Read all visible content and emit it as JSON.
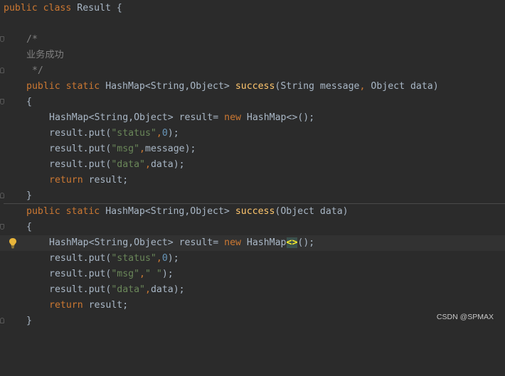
{
  "code": {
    "l1": {
      "kw1": "public",
      "kw2": "class",
      "name": "Result",
      "brace": "{"
    },
    "l3": {
      "text": "/*"
    },
    "l4": {
      "text": "业务成功"
    },
    "l5": {
      "text": " */"
    },
    "l6": {
      "kw1": "public",
      "kw2": "static",
      "type": "HashMap<String,Object>",
      "fn": "success",
      "params_open": "(String message",
      "comma": ",",
      "params_rest": " Object data)"
    },
    "l7": {
      "brace": "{"
    },
    "l8": {
      "type": "HashMap<String,Object> result= ",
      "kw": "new",
      "rest": " HashMap<>();"
    },
    "l9": {
      "pre": "result.put(",
      "str": "\"status\"",
      "comma": ",",
      "num": "0",
      "post": ");"
    },
    "l10": {
      "pre": "result.put(",
      "str": "\"msg\"",
      "comma": ",",
      "post": "message);"
    },
    "l11": {
      "pre": "result.put(",
      "str": "\"data\"",
      "comma": ",",
      "post": "data);"
    },
    "l12": {
      "kw": "return",
      "post": " result;"
    },
    "l13": {
      "brace": "}"
    },
    "l14": {
      "kw1": "public",
      "kw2": "static",
      "type": "HashMap<String,Object>",
      "fn": "success",
      "params": "(Object data)"
    },
    "l15": {
      "brace": "{"
    },
    "l16": {
      "type": "HashMap<String,Object> result= ",
      "kw": "new",
      "mid": " HashMap",
      "hl": "<>",
      "post": "();"
    },
    "l17": {
      "pre": "result.put(",
      "str": "\"status\"",
      "comma": ",",
      "num": "0",
      "post": ");"
    },
    "l18": {
      "pre": "result.put(",
      "str": "\"msg\"",
      "comma": ",",
      "str2": "\" \"",
      "post": ");"
    },
    "l19": {
      "pre": "result.put(",
      "str": "\"data\"",
      "comma": ",",
      "post": "data);"
    },
    "l20": {
      "kw": "return",
      "post": " result;"
    },
    "l21": {
      "brace": "}"
    }
  },
  "watermark": "CSDN @SPMAX",
  "icons": {
    "fold": "fold-marker-icon",
    "bulb": "lightbulb-icon"
  },
  "colors": {
    "background": "#2b2b2b",
    "keyword": "#cc7832",
    "function": "#ffc66d",
    "string": "#6a8759",
    "number": "#6897bb",
    "comment": "#808080",
    "text": "#a9b7c6"
  }
}
